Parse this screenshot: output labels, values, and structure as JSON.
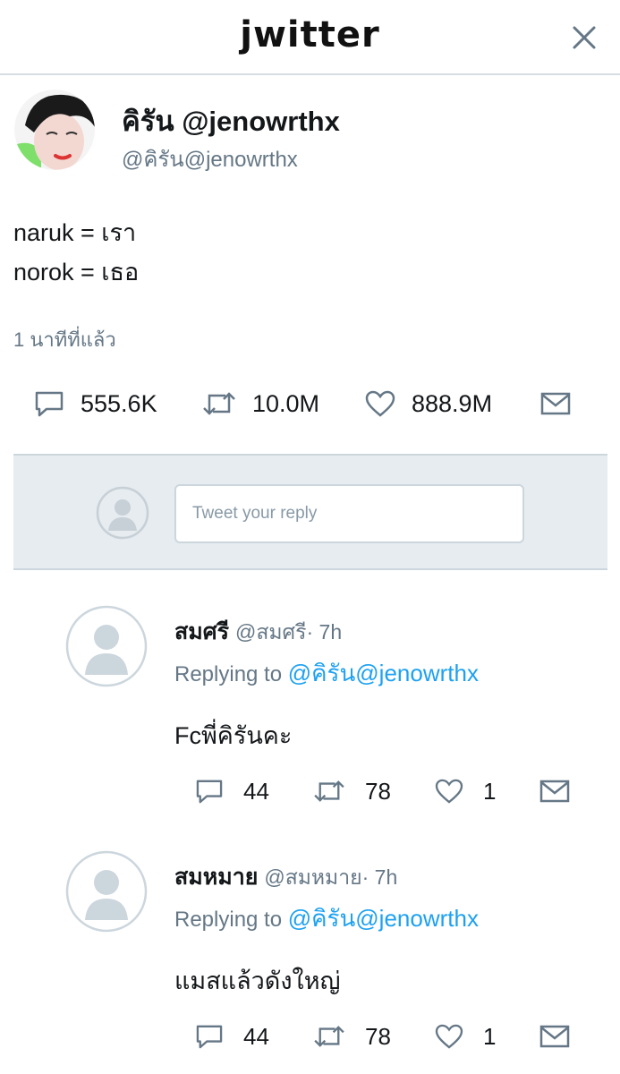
{
  "header": {
    "logo": "jwitter",
    "close_icon": "close-icon"
  },
  "tweet": {
    "author_name": "คิรัน @jenowrthx",
    "author_handle": "@คิรัน@jenowrthx",
    "line1": "naruk = เรา",
    "line2": "norok = เธอ",
    "time": "1 นาทีที่แล้ว",
    "stats": {
      "replies": "555.6K",
      "retweets": "10.0M",
      "likes": "888.9M"
    },
    "icons": [
      "reply-icon",
      "retweet-icon",
      "like-icon",
      "dm-icon"
    ]
  },
  "compose": {
    "placeholder": "Tweet your reply"
  },
  "replies": [
    {
      "name": "สมศรี",
      "handle_time": "@สมศรี· 7h",
      "replying_prefix": "Replying to",
      "mention": "@คิรัน@jenowrthx",
      "text": "Fcพี่คิรันคะ",
      "replies": "44",
      "retweets": "78",
      "likes": "1"
    },
    {
      "name": "สมหมาย",
      "handle_time": "@สมหมาย· 7h",
      "replying_prefix": "Replying to",
      "mention": "@คิรัน@jenowrthx",
      "text": "แมสแล้วดังใหญ่",
      "replies": "44",
      "retweets": "78",
      "likes": "1"
    }
  ],
  "colors": {
    "text": "#14171a",
    "secondary": "#657786",
    "link": "#1da1f2",
    "compose_bg": "#e6ecf0"
  }
}
